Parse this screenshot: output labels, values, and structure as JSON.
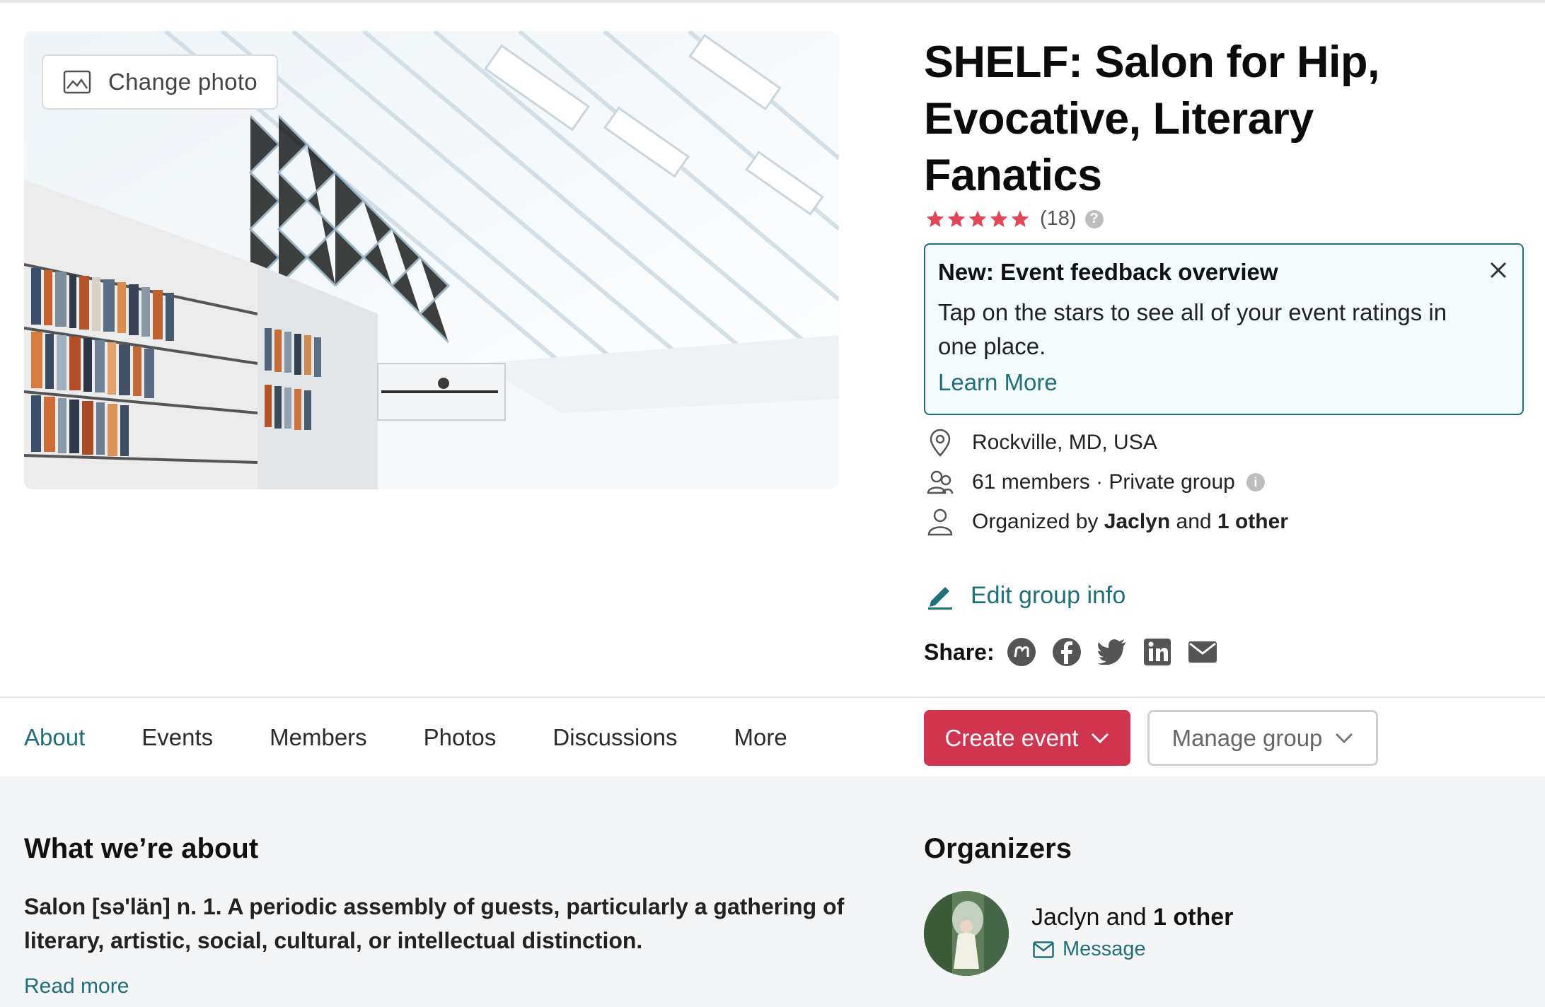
{
  "hero": {
    "change_photo_label": "Change photo"
  },
  "group": {
    "title": "SHELF: Salon for Hip, Evocative, Literary Fanatics",
    "rating_stars": 5,
    "rating_count": "(18)",
    "location": "Rockville, MD, USA",
    "members": "61 members · Private group",
    "organized_prefix": "Organized by ",
    "organizer_name": "Jaclyn",
    "organized_and": " and ",
    "organizer_other": "1 other"
  },
  "feedback": {
    "heading": "New: Event feedback overview",
    "body": "Tap on the stars to see all of your event ratings in one place.",
    "link": "Learn More"
  },
  "actions": {
    "edit_group_info": "Edit group info",
    "share_label": "Share:",
    "share_icons": [
      "meetup-icon",
      "facebook-icon",
      "twitter-icon",
      "linkedin-icon",
      "email-icon"
    ]
  },
  "tabs": [
    "About",
    "Events",
    "Members",
    "Photos",
    "Discussions",
    "More"
  ],
  "active_tab": "About",
  "buttons": {
    "create_event": "Create event",
    "manage_group": "Manage group"
  },
  "about": {
    "heading": "What we’re about",
    "body": "Salon [sə'län] n. 1. A periodic assembly of guests, particularly a gathering of literary, artistic, social, cultural, or intellectual distinction.",
    "read_more": "Read more"
  },
  "organizers": {
    "heading": "Organizers",
    "name": "Jaclyn",
    "and": " and ",
    "other": "1 other",
    "message": "Message"
  },
  "colors": {
    "accent_teal": "#1f6f7a",
    "brand_red": "#d1344f",
    "star_red": "#e0485a",
    "lower_bg": "#f4f5f7"
  }
}
